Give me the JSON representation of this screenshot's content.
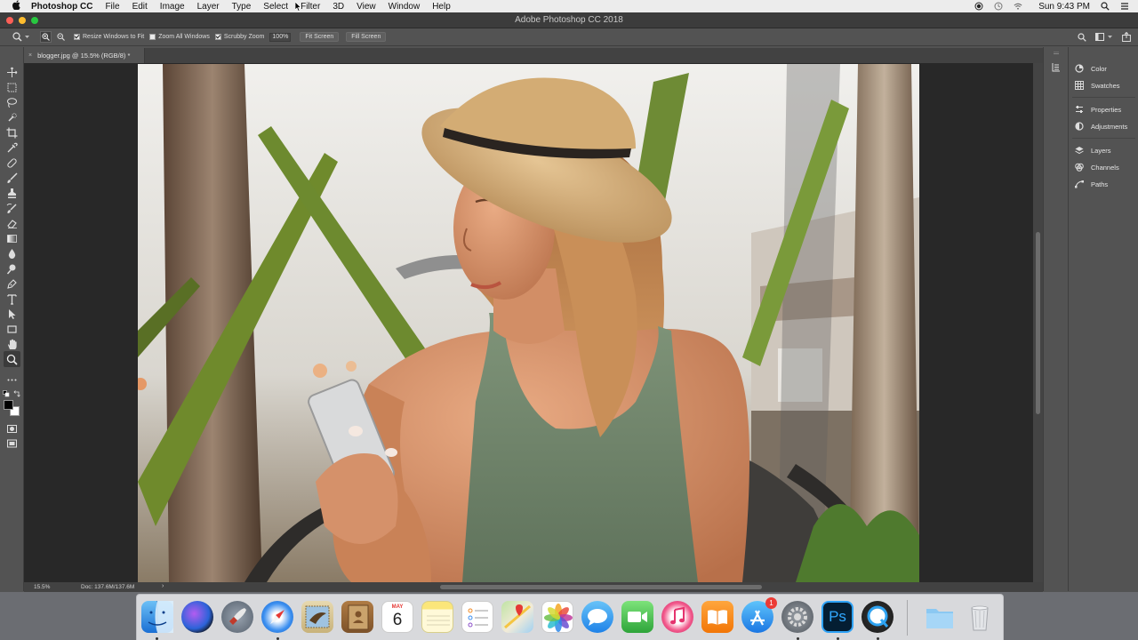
{
  "menubar": {
    "app_name": "Photoshop CC",
    "items": [
      "File",
      "Edit",
      "Image",
      "Layer",
      "Type",
      "Select",
      "Filter",
      "3D",
      "View",
      "Window",
      "Help"
    ],
    "clock": "Sun 9:43 PM"
  },
  "window": {
    "title": "Adobe Photoshop CC 2018"
  },
  "options_bar": {
    "resize_windows_label": "Resize Windows to Fit",
    "zoom_all_windows_label": "Zoom All Windows",
    "scrubby_zoom_label": "Scrubby Zoom",
    "zoom_value": "100%",
    "fit_screen_label": "Fit Screen",
    "fill_screen_label": "Fill Screen",
    "resize_windows_checked": true,
    "zoom_all_windows_checked": false,
    "scrubby_zoom_checked": true
  },
  "document": {
    "tab_label": "blogger.jpg @ 15.5% (RGB/8) *",
    "tab_close": "×"
  },
  "status": {
    "zoom": "15.5%",
    "doc_size": "Doc: 137.6M/137.6M",
    "arrow": "›"
  },
  "panels": {
    "group1": [
      {
        "label": "Color",
        "icon": "color-wheel-icon"
      },
      {
        "label": "Swatches",
        "icon": "grid-icon"
      }
    ],
    "group2": [
      {
        "label": "Properties",
        "icon": "sliders-icon"
      },
      {
        "label": "Adjustments",
        "icon": "half-circle-icon"
      }
    ],
    "group3": [
      {
        "label": "Layers",
        "icon": "layers-icon"
      },
      {
        "label": "Channels",
        "icon": "channels-icon"
      },
      {
        "label": "Paths",
        "icon": "pen-path-icon"
      }
    ]
  },
  "dock": {
    "calendar_month": "MAY",
    "calendar_day": "6",
    "appstore_badge": "1",
    "photoshop_label": "Ps"
  },
  "colors": {
    "foreground": "#000000",
    "background": "#ffffff",
    "ui_panel": "#535353"
  }
}
